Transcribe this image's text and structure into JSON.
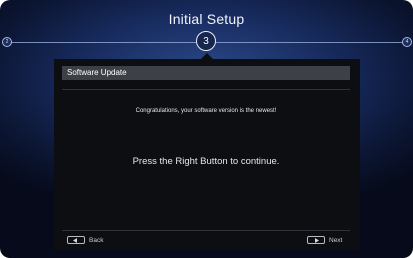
{
  "header": {
    "title": "Initial Setup",
    "step_prev": "2",
    "step_current": "3",
    "step_next": "4"
  },
  "panel": {
    "title": "Software Update",
    "message": "Congratulations, your software version is the newest!",
    "instruction": "Press the Right Button to continue."
  },
  "footer": {
    "back_label": "Back",
    "next_label": "Next"
  }
}
